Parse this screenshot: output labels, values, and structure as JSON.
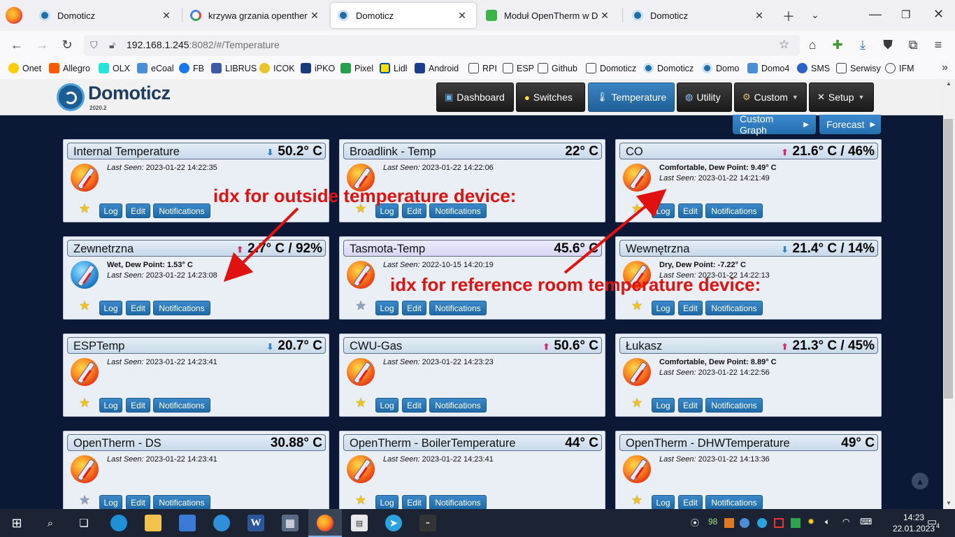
{
  "browser": {
    "tabs": [
      {
        "title": "Domoticz",
        "icon": "domoticz-favicon"
      },
      {
        "title": "krzywa grzania opentherm - S",
        "icon": "google-favicon"
      },
      {
        "title": "Domoticz",
        "icon": "domoticz-favicon"
      },
      {
        "title": "Moduł OpenTherm w Domoti",
        "icon": "house-favicon"
      },
      {
        "title": "Domoticz",
        "icon": "domoticz-favicon"
      }
    ],
    "url_host": "192.168.1.245",
    "url_rest": ":8082/#/Temperature",
    "bookmarks": [
      "Onet",
      "Allegro",
      "OLX",
      "eCoal",
      "FB",
      "LIBRUS",
      "ICOK",
      "iPKO",
      "Pixel",
      "Lidl",
      "Android",
      "RPI",
      "ESP",
      "Github",
      "Domoticz",
      "Domoticz",
      "Domo",
      "Domo4",
      "SMS",
      "Serwisy",
      "IFM"
    ]
  },
  "domoticz": {
    "brand": "Domoticz",
    "version": "2020.2",
    "menu": [
      {
        "label": "Dashboard",
        "icon": "dashboard-icon"
      },
      {
        "label": "Switches",
        "icon": "bulb-icon"
      },
      {
        "label": "Temperature",
        "icon": "thermometer-icon"
      },
      {
        "label": "Utility",
        "icon": "globe-icon"
      },
      {
        "label": "Custom",
        "icon": "gear-icon"
      },
      {
        "label": "Setup",
        "icon": "tools-icon"
      }
    ],
    "custom_graph": "Custom Graph",
    "forecast": "Forecast",
    "buttons": {
      "log": "Log",
      "edit": "Edit",
      "notifications": "Notifications"
    },
    "last_seen_label": "Last Seen:",
    "colors": {
      "accent": "#2a75b5",
      "background": "#0c1936",
      "annotation": "#e0120f"
    }
  },
  "devices": [
    {
      "name": "Internal Temperature",
      "value": "50.2° C",
      "trend": "down",
      "status": "",
      "last_seen": "2023-01-22 14:22:35",
      "favorite": true
    },
    {
      "name": "Broadlink - Temp",
      "value": "22° C",
      "trend": "",
      "status": "",
      "last_seen": "2023-01-22 14:22:06",
      "favorite": true
    },
    {
      "name": "CO",
      "value": "21.6° C / 46%",
      "trend": "up",
      "status": "Comfortable, Dew Point: 9.49° C",
      "last_seen": "2023-01-22 14:21:49",
      "favorite": true
    },
    {
      "name": "Zewnetrzna",
      "value": "2.7° C / 92%",
      "trend": "up",
      "status": "Wet, Dew Point: 1.53° C",
      "last_seen": "2023-01-22 14:23:08",
      "favorite": true
    },
    {
      "name": "Tasmota-Temp",
      "value": "45.6° C",
      "trend": "",
      "status": "",
      "last_seen": "2022-10-15 14:20:19",
      "favorite": false
    },
    {
      "name": "Wewnętrzna",
      "value": "21.4° C / 14%",
      "trend": "down",
      "status": "Dry, Dew Point: -7.22° C",
      "last_seen": "2023-01-22 14:22:13",
      "favorite": true
    },
    {
      "name": "ESPTemp",
      "value": "20.7° C",
      "trend": "down",
      "status": "",
      "last_seen": "2023-01-22 14:23:41",
      "favorite": true
    },
    {
      "name": "CWU-Gas",
      "value": "50.6° C",
      "trend": "up",
      "status": "",
      "last_seen": "2023-01-22 14:23:23",
      "favorite": true
    },
    {
      "name": "Łukasz",
      "value": "21.3° C / 45%",
      "trend": "up",
      "status": "Comfortable, Dew Point: 8.89° C",
      "last_seen": "2023-01-22 14:22:56",
      "favorite": true
    },
    {
      "name": "OpenTherm - DS",
      "value": "30.88° C",
      "trend": "",
      "status": "",
      "last_seen": "2023-01-22 14:23:41",
      "favorite": false
    },
    {
      "name": "OpenTherm - BoilerTemperature",
      "value": "44° C",
      "trend": "",
      "status": "",
      "last_seen": "2023-01-22 14:23:41",
      "favorite": true
    },
    {
      "name": "OpenTherm - DHWTemperature",
      "value": "49° C",
      "trend": "",
      "status": "",
      "last_seen": "2023-01-22 14:13:36",
      "favorite": true
    }
  ],
  "annotations": {
    "outside": "idx for outside temperature device:",
    "reference": "idx for reference room temperature device:"
  },
  "taskbar": {
    "battery": "98",
    "time": "14:23",
    "date": "22.01.2023",
    "notifications": "4"
  }
}
